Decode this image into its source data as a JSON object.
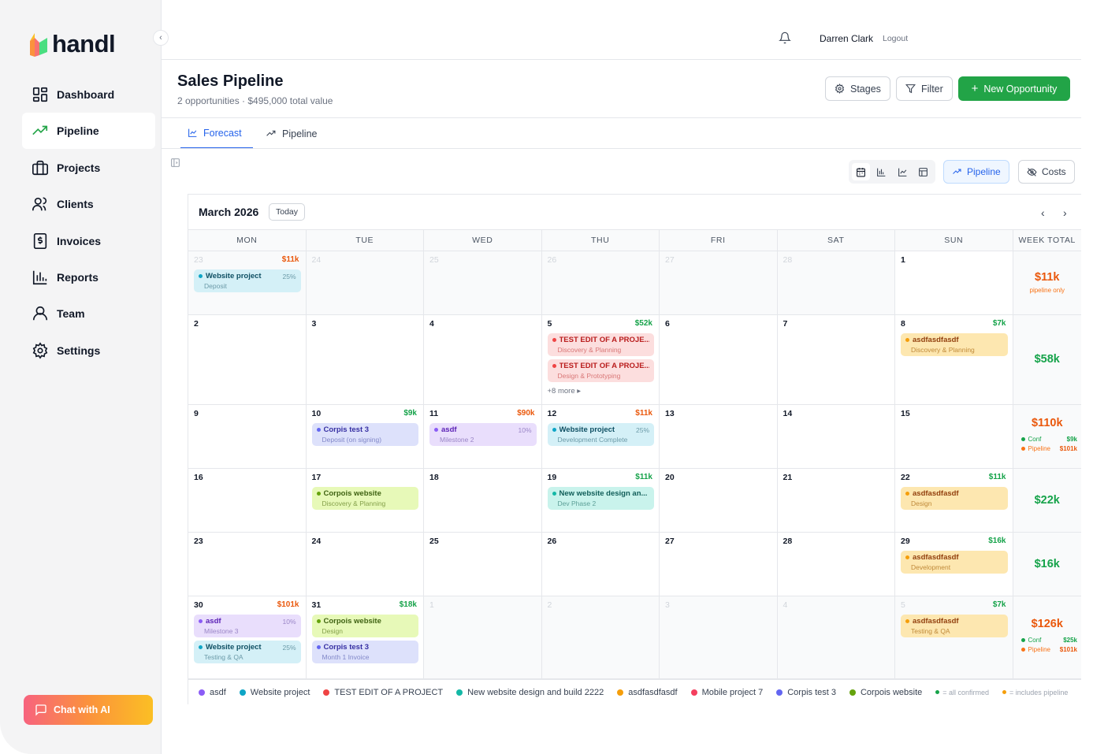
{
  "app": {
    "name": "handl"
  },
  "sidebar": {
    "items": [
      {
        "label": "Dashboard",
        "icon": "grid-icon"
      },
      {
        "label": "Pipeline",
        "icon": "trend-icon",
        "active": true
      },
      {
        "label": "Projects",
        "icon": "briefcase-icon"
      },
      {
        "label": "Clients",
        "icon": "users-icon"
      },
      {
        "label": "Invoices",
        "icon": "invoice-icon"
      },
      {
        "label": "Reports",
        "icon": "bar-chart-icon"
      },
      {
        "label": "Team",
        "icon": "user-icon"
      },
      {
        "label": "Settings",
        "icon": "gear-icon"
      }
    ],
    "chat_label": "Chat with AI"
  },
  "topbar": {
    "user": "Darren Clark",
    "logout": "Logout"
  },
  "header": {
    "title": "Sales Pipeline",
    "subtitle": "2 opportunities · $495,000 total value",
    "stages_label": "Stages",
    "filter_label": "Filter",
    "new_label": "New Opportunity"
  },
  "tabs": [
    {
      "label": "Forecast",
      "active": true
    },
    {
      "label": "Pipeline"
    }
  ],
  "toggles": {
    "pipeline": "Pipeline",
    "costs": "Costs"
  },
  "calendar": {
    "month": "March 2026",
    "today_label": "Today",
    "headers": [
      "MON",
      "TUE",
      "WED",
      "THU",
      "FRI",
      "SAT",
      "SUN",
      "WEEK TOTAL"
    ],
    "weeks": [
      {
        "height": 81,
        "days": [
          {
            "n": "23",
            "other": true,
            "amt": "$11k",
            "amt_color": "#ea580c",
            "events": [
              {
                "name": "Website project",
                "stage": "Deposit",
                "pct": "25%",
                "c": "teal"
              }
            ]
          },
          {
            "n": "24",
            "other": true
          },
          {
            "n": "25",
            "other": true
          },
          {
            "n": "26",
            "other": true
          },
          {
            "n": "27",
            "other": true
          },
          {
            "n": "28",
            "other": true
          },
          {
            "n": "1"
          }
        ],
        "total": {
          "amt": "$11k",
          "color": "#ea580c",
          "sub": "pipeline only"
        }
      },
      {
        "height": 114,
        "days": [
          {
            "n": "2"
          },
          {
            "n": "3"
          },
          {
            "n": "4"
          },
          {
            "n": "5",
            "amt": "$52k",
            "amt_color": "#16a34a",
            "events": [
              {
                "name": "TEST EDIT OF A PROJE...",
                "stage": "Discovery & Planning",
                "c": "red"
              },
              {
                "name": "TEST EDIT OF A PROJE...",
                "stage": "Design & Prototyping",
                "c": "red"
              }
            ],
            "more": "+8 more ▸"
          },
          {
            "n": "6"
          },
          {
            "n": "7"
          },
          {
            "n": "8",
            "amt": "$7k",
            "amt_color": "#16a34a",
            "events": [
              {
                "name": "asdfasdfasdf",
                "stage": "Discovery & Planning",
                "c": "orange"
              }
            ]
          }
        ],
        "total": {
          "amt": "$58k",
          "color": "#16a34a"
        }
      },
      {
        "height": 81,
        "days": [
          {
            "n": "9"
          },
          {
            "n": "10",
            "amt": "$9k",
            "amt_color": "#16a34a",
            "events": [
              {
                "name": "Corpis test 3",
                "stage": "Deposit (on signing)",
                "c": "indigo"
              }
            ]
          },
          {
            "n": "11",
            "amt": "$90k",
            "amt_color": "#ea580c",
            "events": [
              {
                "name": "asdf",
                "stage": "Milestone 2",
                "pct": "10%",
                "c": "purple"
              }
            ]
          },
          {
            "n": "12",
            "amt": "$11k",
            "amt_color": "#ea580c",
            "events": [
              {
                "name": "Website project",
                "stage": "Development Complete",
                "pct": "25%",
                "c": "teal"
              }
            ]
          },
          {
            "n": "13"
          },
          {
            "n": "14"
          },
          {
            "n": "15"
          }
        ],
        "total": {
          "amt": "$110k",
          "color": "#ea580c",
          "conf": "$9k",
          "pipe": "$101k"
        }
      },
      {
        "height": 81,
        "days": [
          {
            "n": "16"
          },
          {
            "n": "17",
            "events": [
              {
                "name": "Corpois website",
                "stage": "Discovery & Planning",
                "c": "lime"
              }
            ]
          },
          {
            "n": "18"
          },
          {
            "n": "19",
            "amt": "$11k",
            "amt_color": "#16a34a",
            "events": [
              {
                "name": "New website design an...",
                "stage": "Dev Phase 2",
                "c": "cyan"
              }
            ]
          },
          {
            "n": "20"
          },
          {
            "n": "21"
          },
          {
            "n": "22",
            "amt": "$11k",
            "amt_color": "#16a34a",
            "events": [
              {
                "name": "asdfasdfasdf",
                "stage": "Design",
                "c": "orange"
              }
            ]
          }
        ],
        "total": {
          "amt": "$22k",
          "color": "#16a34a"
        }
      },
      {
        "height": 81,
        "days": [
          {
            "n": "23"
          },
          {
            "n": "24"
          },
          {
            "n": "25"
          },
          {
            "n": "26"
          },
          {
            "n": "27"
          },
          {
            "n": "28"
          },
          {
            "n": "29",
            "amt": "$16k",
            "amt_color": "#16a34a",
            "events": [
              {
                "name": "asdfasdfasdf",
                "stage": "Development",
                "c": "orange"
              }
            ]
          }
        ],
        "total": {
          "amt": "$16k",
          "color": "#16a34a"
        }
      },
      {
        "height": 105,
        "days": [
          {
            "n": "30",
            "amt": "$101k",
            "amt_color": "#ea580c",
            "events": [
              {
                "name": "asdf",
                "stage": "Milestone 3",
                "pct": "10%",
                "c": "purple"
              },
              {
                "name": "Website project",
                "stage": "Testing & QA",
                "pct": "25%",
                "c": "teal"
              }
            ]
          },
          {
            "n": "31",
            "amt": "$18k",
            "amt_color": "#16a34a",
            "events": [
              {
                "name": "Corpois website",
                "stage": "Design",
                "c": "lime"
              },
              {
                "name": "Corpis test 3",
                "stage": "Month 1 Invoice",
                "c": "indigo"
              }
            ]
          },
          {
            "n": "1",
            "other": true
          },
          {
            "n": "2",
            "other": true
          },
          {
            "n": "3",
            "other": true
          },
          {
            "n": "4",
            "other": true
          },
          {
            "n": "5",
            "other": true,
            "amt": "$7k",
            "amt_color": "#16a34a",
            "events": [
              {
                "name": "asdfasdfasdf",
                "stage": "Testing & QA",
                "c": "orange"
              }
            ]
          }
        ],
        "total": {
          "amt": "$126k",
          "color": "#ea580c",
          "conf": "$25k",
          "pipe": "$101k"
        }
      }
    ],
    "conf_label": "Conf",
    "pipe_label": "Pipeline"
  },
  "colors": {
    "teal": {
      "bg": "#d4f0f7",
      "dot": "#0ea5c6",
      "name": "#0e4f63",
      "stage": "#6b9aa8"
    },
    "red": {
      "bg": "#fcdede",
      "dot": "#ef4444",
      "name": "#b91c1c",
      "stage": "#d97777"
    },
    "orange": {
      "bg": "#fde7b0",
      "dot": "#f59e0b",
      "name": "#92400e",
      "stage": "#c08a3a"
    },
    "indigo": {
      "bg": "#dde1fb",
      "dot": "#6366f1",
      "name": "#3730a3",
      "stage": "#8288c9"
    },
    "purple": {
      "bg": "#e9defc",
      "dot": "#8b5cf6",
      "name": "#5b21b6",
      "stage": "#9a86c7"
    },
    "lime": {
      "bg": "#e7f9b8",
      "dot": "#65a30d",
      "name": "#3f6212",
      "stage": "#84a04a"
    },
    "cyan": {
      "bg": "#c9f3ec",
      "dot": "#14b8a6",
      "name": "#115e59",
      "stage": "#5c9f97"
    }
  },
  "legend": [
    {
      "label": "asdf",
      "color": "#8b5cf6"
    },
    {
      "label": "Website project",
      "color": "#0ea5c6"
    },
    {
      "label": "TEST EDIT OF A PROJECT",
      "color": "#ef4444"
    },
    {
      "label": "New website design and build 2222",
      "color": "#14b8a6"
    },
    {
      "label": "asdfasdfasdf",
      "color": "#f59e0b"
    },
    {
      "label": "Mobile project 7",
      "color": "#f43f5e"
    },
    {
      "label": "Corpis test 3",
      "color": "#6366f1"
    },
    {
      "label": "Corpois website",
      "color": "#65a30d"
    }
  ],
  "legend_notes": {
    "confirmed": "= all confirmed",
    "pipeline": "= includes pipeline"
  }
}
